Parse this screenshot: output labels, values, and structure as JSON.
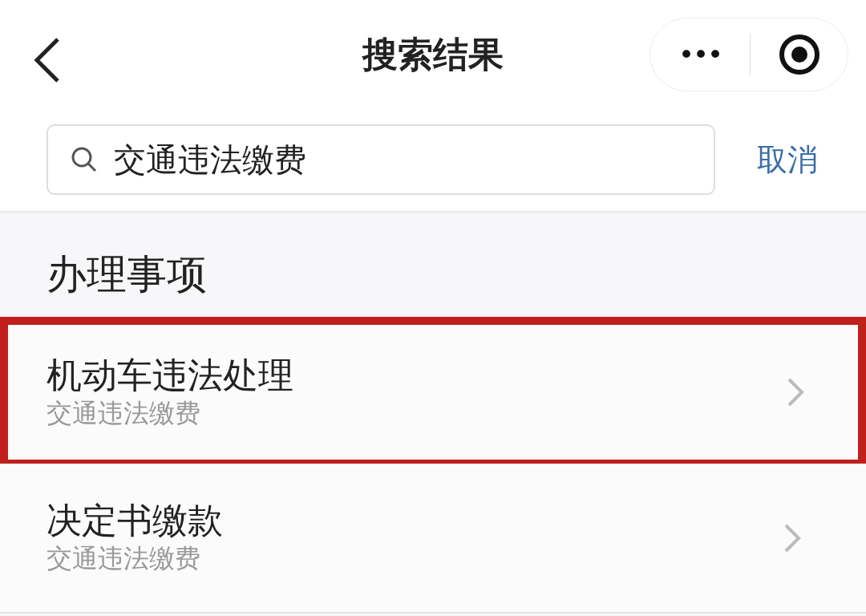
{
  "header": {
    "title": "搜索结果",
    "menu_icon": "•••"
  },
  "search": {
    "value": "交通违法缴费",
    "cancel": "取消"
  },
  "section": {
    "title": "办理事项"
  },
  "items": [
    {
      "title": "机动车违法处理",
      "subtitle": "交通违法缴费",
      "highlighted": true
    },
    {
      "title": "决定书缴款",
      "subtitle": "交通违法缴费",
      "highlighted": false
    }
  ]
}
